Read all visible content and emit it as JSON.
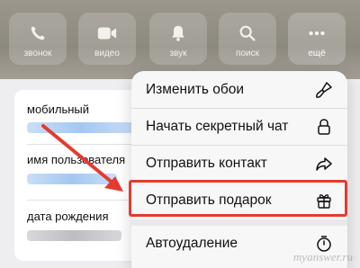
{
  "header": {
    "actions": [
      {
        "label": "звонок",
        "icon": "phone-icon"
      },
      {
        "label": "видео",
        "icon": "video-icon"
      },
      {
        "label": "звук",
        "icon": "bell-icon"
      },
      {
        "label": "поиск",
        "icon": "search-icon"
      },
      {
        "label": "ещё",
        "icon": "more-icon"
      }
    ]
  },
  "info": {
    "mobile_label": "мобильный",
    "username_label": "имя пользователя",
    "birthday_label": "дата рождения"
  },
  "menu": {
    "items": [
      {
        "label": "Изменить обои",
        "icon": "brush-icon"
      },
      {
        "label": "Начать секретный чат",
        "icon": "lock-icon"
      },
      {
        "label": "Отправить контакт",
        "icon": "share-icon"
      },
      {
        "label": "Отправить подарок",
        "icon": "gift-icon"
      },
      {
        "label": "Автоудаление",
        "icon": "timer-icon"
      }
    ]
  },
  "colors": {
    "accent_highlight": "#e53a2f",
    "blurred_link": "#9fc4f0"
  },
  "watermark": "myanswer.ru"
}
